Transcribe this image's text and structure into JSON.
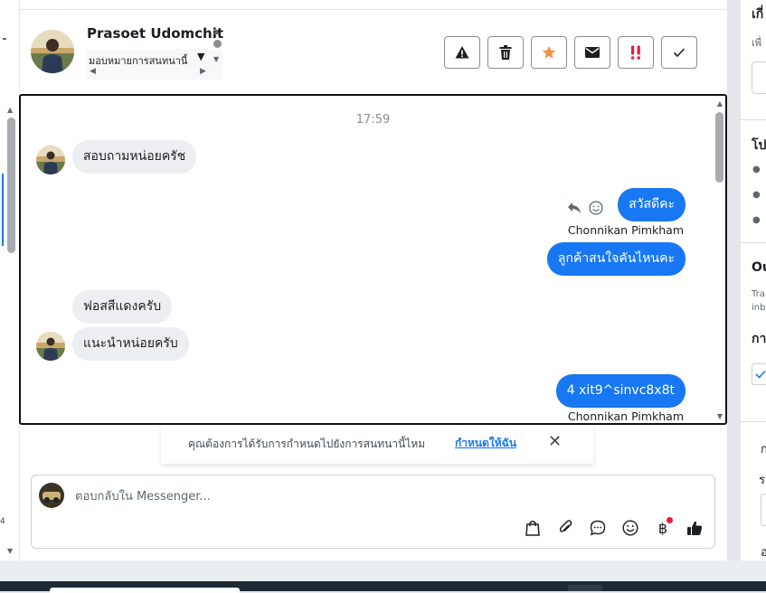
{
  "header": {
    "contact_name": "Prasoet Udomchit",
    "assign_label": "มอบหมายการสนทนานี้",
    "actions": [
      {
        "name": "spam-button",
        "icon": "warning-icon"
      },
      {
        "name": "delete-button",
        "icon": "trash-icon"
      },
      {
        "name": "star-button",
        "icon": "star-icon"
      },
      {
        "name": "mark-unread-button",
        "icon": "envelope-icon"
      },
      {
        "name": "follow-up-button",
        "icon": "double-exclamation-icon"
      },
      {
        "name": "mark-done-button",
        "icon": "check-icon"
      }
    ]
  },
  "conversation": {
    "timestamp": "17:59",
    "messages": [
      {
        "direction": "in",
        "text": "สอบถามหน่อยครัช",
        "show_avatar": true
      },
      {
        "direction": "out",
        "text": "สวัสดีคะ",
        "sender": "Chonnikan Pimkham"
      },
      {
        "direction": "out",
        "text": "ลูกค้าสนใจคันไหนคะ"
      },
      {
        "direction": "in",
        "text": "ฟอสสีแดงครับ"
      },
      {
        "direction": "in",
        "text": "แนะนำหน่อยครับ",
        "show_avatar": true
      },
      {
        "direction": "out",
        "text": "4 xit9^sinvc8x8t",
        "sender": "Chonnikan Pimkham"
      }
    ]
  },
  "assign_prompt": {
    "text": "คุณต้องการได้รับการกำหนดไปยังการสนทนานี้ไหม",
    "link": "กำหนดให้ฉัน"
  },
  "composer": {
    "placeholder": "ตอบกลับใน Messenger..."
  },
  "left_gutter": {
    "number": "4"
  },
  "right_panel": {
    "section1_title": "เกี่",
    "section1_sub": "เพื่",
    "section2_title": "โป",
    "section3_title": "Ou",
    "section3_body_1": "Tra",
    "section3_body_2": "inb",
    "section4_title": "กา",
    "section5_title": "ก",
    "section5_sub": "ร",
    "section6_title": "อ"
  },
  "colors": {
    "accent": "#1877f2",
    "incoming_bubble": "#eceef1",
    "star": "#f5923e",
    "follow_up": "#e41e3f"
  }
}
